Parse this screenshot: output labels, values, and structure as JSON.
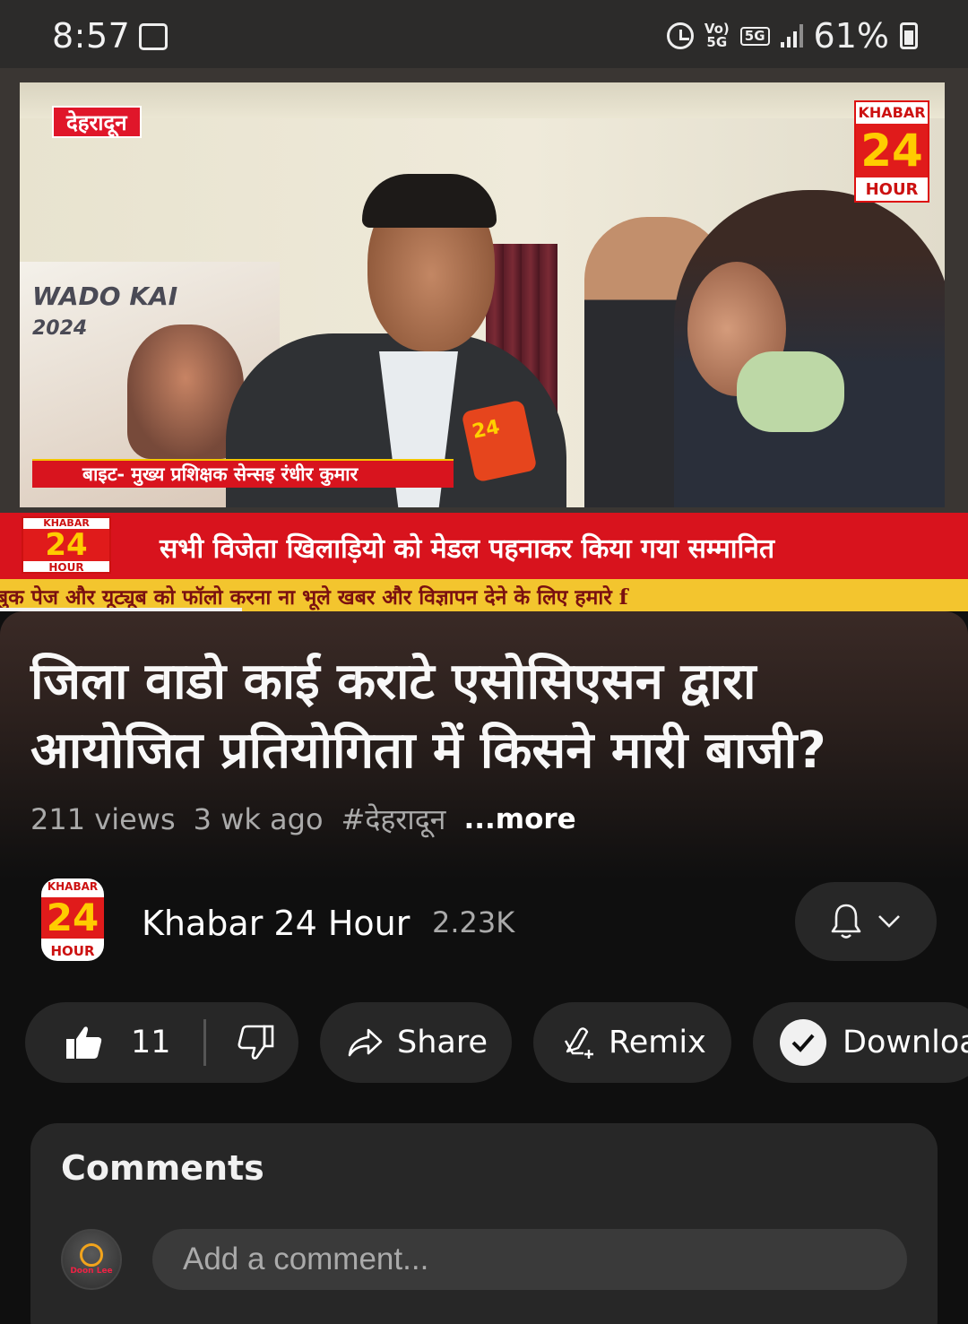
{
  "status_bar": {
    "time": "8:57",
    "volte_label": "Vo)\n5G",
    "network_label": "5G",
    "battery_text": "61%"
  },
  "video": {
    "location_tag": "देहरादून",
    "corner_logo": {
      "top": "KHABAR",
      "number": "24",
      "bottom": "HOUR"
    },
    "lower_third_caption": "बाइट- मुख्य प्रशिक्षक सेन्सइ रंधीर कुमार",
    "banner_text": "WADO KAI",
    "banner_year": "2024",
    "headline_logo": {
      "top": "KHABAR",
      "number": "24",
      "bottom": "HOUR"
    },
    "headline": "सभी विजेता खिलाड़ियो को मेडल पहनाकर किया गया सम्मानित",
    "ticker": "बुक पेज और यूट्यूब को फॉलो करना ना भूले    खबर और विज्ञापन देने के लिए हमारे f",
    "progress_fraction": 0.25
  },
  "details": {
    "title": "जिला वाडो काई कराटे एसोसिएसन द्वारा आयोजित प्रतियोगिता में किसने मारी बाजी?",
    "views": "211 views",
    "age": "3 wk ago",
    "hashtag": "#देहरादून",
    "more": "...more"
  },
  "channel": {
    "logo": {
      "top": "KHABAR",
      "number": "24",
      "bottom": "HOUR"
    },
    "name": "Khabar 24 Hour",
    "subscribers": "2.23K"
  },
  "actions": {
    "like_count": "11",
    "share_label": "Share",
    "remix_label": "Remix",
    "download_label": "Downloa"
  },
  "comments": {
    "title": "Comments",
    "avatar_text": "Doon Lee",
    "placeholder": "Add a comment..."
  }
}
